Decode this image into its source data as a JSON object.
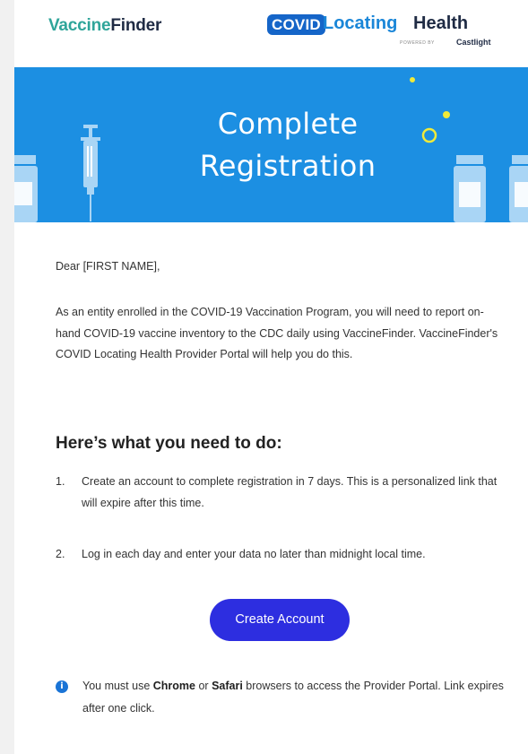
{
  "header": {
    "vf_logo_part1": "Vaccine",
    "vf_logo_part2": "Finder",
    "clh_badge": "COVID",
    "clh_word1": "Locating",
    "clh_word2": "Health",
    "clh_powered": "powered by",
    "clh_castlight": "Castlight"
  },
  "banner": {
    "title_line1": "Complete",
    "title_line2": "Registration",
    "bg_color": "#1c8fe2"
  },
  "body": {
    "greeting": "Dear [FIRST NAME],",
    "intro": "As an entity enrolled in the COVID-19 Vaccination Program, you will need to report on-hand COVID-19 vaccine inventory to the CDC daily using VaccineFinder. VaccineFinder's COVID Locating Health Provider Portal will help you do this.",
    "section_heading": "Here’s what you need to do:",
    "steps": [
      {
        "num": "1.",
        "text": "Create an account to complete registration in 7 days. This is a personalized link that will expire after this time."
      },
      {
        "num": "2.",
        "text": "Log in each day and enter your data no later than midnight local time."
      }
    ],
    "cta_label": "Create Account",
    "cta_color": "#2d2ee0",
    "note": {
      "icon": "info-icon",
      "part1": "You must use ",
      "browser1": "Chrome",
      "part2": " or ",
      "browser2": "Safari",
      "part3": " browsers to access the Provider Portal. Link expires after one click."
    }
  }
}
